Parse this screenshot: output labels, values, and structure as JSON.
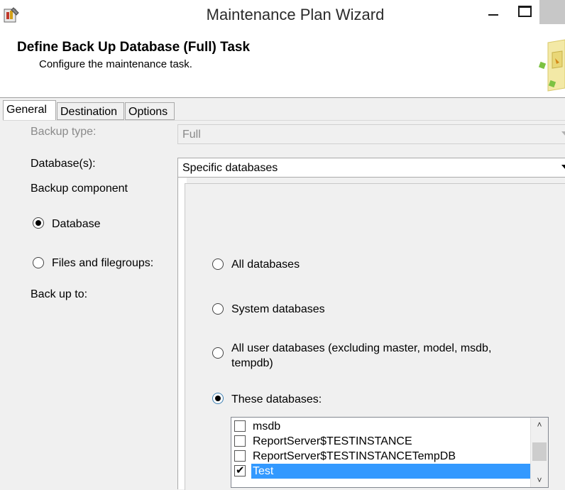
{
  "window": {
    "title": "Maintenance Plan Wizard",
    "icon": "wizard-app-icon"
  },
  "header": {
    "title": "Define Back Up Database (Full) Task",
    "subtitle": "Configure the maintenance task."
  },
  "tabs": [
    {
      "label": "General",
      "active": true
    },
    {
      "label": "Destination",
      "active": false
    },
    {
      "label": "Options",
      "active": false
    }
  ],
  "general": {
    "backup_type_label": "Backup type:",
    "backup_type_value": "Full",
    "databases_label": "Database(s):",
    "databases_value": "Specific databases",
    "backup_component_label": "Backup component",
    "component_database_label": "Database",
    "component_files_label": "Files and filegroups:",
    "back_up_to_label": "Back up to:"
  },
  "database_dropdown": {
    "options": [
      {
        "label": "All databases",
        "checked": false
      },
      {
        "label": "System databases",
        "checked": false
      },
      {
        "label": "All user databases  (excluding master, model, msdb, tempdb)",
        "checked": false
      },
      {
        "label": "These databases:",
        "checked": true
      }
    ],
    "databases": [
      {
        "name": "msdb",
        "checked": false,
        "selected": false
      },
      {
        "name": "ReportServer$TESTINSTANCE",
        "checked": false,
        "selected": false
      },
      {
        "name": "ReportServer$TESTINSTANCETempDB",
        "checked": false,
        "selected": false
      },
      {
        "name": "Test",
        "checked": true,
        "selected": true
      }
    ]
  },
  "colors": {
    "selection": "#3399ff",
    "window_bg": "#f0f0f0",
    "focus_border": "#3c7fb1"
  }
}
